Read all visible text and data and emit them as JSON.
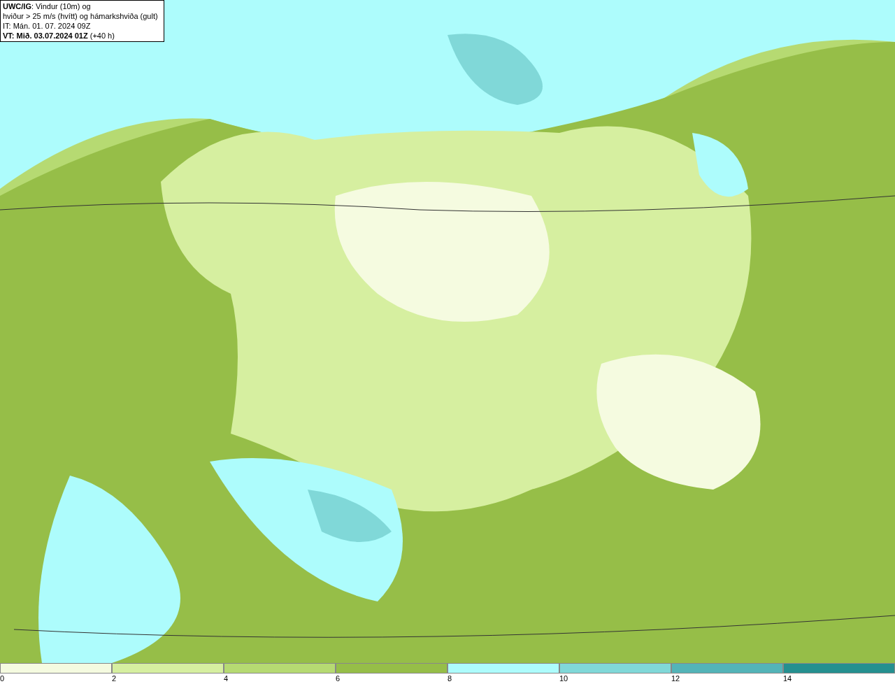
{
  "info_box": {
    "lines": [
      "**UWC/IG**: Vindur (10m) og",
      "hviður > 25 m/s (hvítt) og hámarkshviða (gult)",
      "IT: Mán. 01. 07. 2024 09Z",
      "**VT: Mið. 03.07.2024 01Z** (+40 h)"
    ]
  },
  "legend": [
    {
      "label": "0",
      "color": "#f5fbe0"
    },
    {
      "label": "2",
      "color": "#d6efa0"
    },
    {
      "label": "4",
      "color": "#b6da72"
    },
    {
      "label": "6",
      "color": "#96be48"
    },
    {
      "label": "8",
      "color": "#adfcfc"
    },
    {
      "label": "10",
      "color": "#80d8d8"
    },
    {
      "label": "12",
      "color": "#53b4b8"
    },
    {
      "label": "14",
      "color": "#259090"
    }
  ]
}
